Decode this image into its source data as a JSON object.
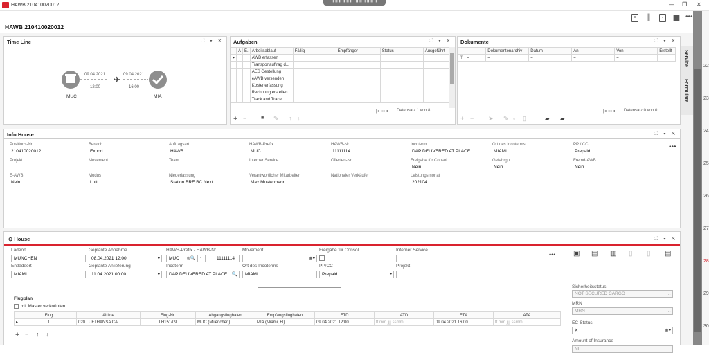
{
  "window": {
    "title": "HAWB 210410020012",
    "drag_handle": "⠿⠿⠿⠿⠿⠿ ⠿⠿⠿⠿⠿⠿"
  },
  "page_title": "HAWB 210410020012",
  "panel_controls": "⛶ ▾ ✕",
  "timeline": {
    "title": "Time Line",
    "origin": "MUC",
    "destination": "MIA",
    "leg1_date": "09.04.2021",
    "leg1_time": "12:00",
    "leg2_date": "09.04.2021",
    "leg2_time": "16:00"
  },
  "aufgaben": {
    "title": "Aufgaben",
    "columns": [
      "A",
      "E.",
      "Arbeitsablauf",
      "Fällig",
      "Empfänger",
      "Status",
      "Ausgeführt"
    ],
    "rows": [
      "AWB erfassen",
      "Transportauftrag d...",
      "AES Gestellung",
      "eAWB versenden",
      "Kostenerfassung",
      "Rechnung erstellen",
      "Track and Trace"
    ],
    "pager": "Datensatz 1 von 8"
  },
  "dokumente": {
    "title": "Dokumente",
    "columns": [
      "Dokumentenarchiv",
      "Datum",
      "An",
      "Von",
      "Erstellt"
    ],
    "filter": "=",
    "pager": "Datensatz 0 von 0"
  },
  "info_house": {
    "title": "Info House",
    "fields": [
      {
        "label": "Positions-Nr.",
        "value": "210410020012"
      },
      {
        "label": "Bereich",
        "value": "Export"
      },
      {
        "label": "Auftragsart",
        "value": "HAWB"
      },
      {
        "label": "HAWB-Prefix",
        "value": "MUC"
      },
      {
        "label": "HAWB-Nr.",
        "value": "11111114"
      },
      {
        "label": "Incoterm",
        "value": "DAP DELIVERED AT PLACE"
      },
      {
        "label": "Ort des Incoterms",
        "value": "MIAMI"
      },
      {
        "label": "PP / CC",
        "value": "Prepaid"
      },
      {
        "label": "Projekt",
        "value": ""
      },
      {
        "label": "Movement",
        "value": ""
      },
      {
        "label": "Team",
        "value": ""
      },
      {
        "label": "Interner Service",
        "value": ""
      },
      {
        "label": "Offerten-Nr.",
        "value": ""
      },
      {
        "label": "Freigabe für Consol",
        "value": "Nein"
      },
      {
        "label": "Gefahrgut",
        "value": "Nein"
      },
      {
        "label": "Fremd-AWB",
        "value": "Nein"
      },
      {
        "label": "E-AWB",
        "value": "Nein"
      },
      {
        "label": "Modus",
        "value": "Luft"
      },
      {
        "label": "Niederlassung",
        "value": "Station BRE BC Next"
      },
      {
        "label": "Verantwortlicher Mitarbeiter",
        "value": "Max Mustermann"
      },
      {
        "label": "Nationaler Verkäufer",
        "value": ""
      },
      {
        "label": "Leistungsmonat",
        "value": "202104"
      }
    ]
  },
  "house": {
    "title": "House",
    "ladeort_label": "Ladeort",
    "ladeort": "MUNCHEN",
    "abholung_label": "Geplante Abnahme",
    "abholung": "08.04.2021 12:00",
    "hawb_label": "HAWB-Prefix - HAWB-Nr.",
    "hawb_prefix": "MUC",
    "hawb_nr": "11111114",
    "movement_label": "Movement",
    "movement": "",
    "freigabe_label": "Freigabe für Consol",
    "service_label": "Interner Service",
    "service": "",
    "entladeort_label": "Entladeort",
    "entladeort": "MIAMI",
    "anlieferung_label": "Geplante Anlieferung",
    "anlieferung": "11.04.2021 00:00",
    "incoterm_label": "Incoterm",
    "incoterm": "DAP DELIVERED AT PLACE",
    "ort_label": "Ort des Incoterms",
    "ort": "MIAMI",
    "ppcc_label": "PP/CC",
    "ppcc": "Prepaid",
    "projekt_label": "Projekt",
    "projekt": "",
    "flugplan_label": "Flugplan",
    "master_label": "mit Master verknüpfen",
    "flight_columns": [
      "Flug",
      "Airline",
      "Flug-Nr.",
      "Abgangsflughafen",
      "Empfangsflughafen",
      "ETD",
      "ATD",
      "ETA",
      "ATA"
    ],
    "flight": {
      "flug": "1",
      "airline": "020 LUFTHANSA CA",
      "flugnr": "LH151/09",
      "abgang": "MUC (Muenchen)",
      "empfang": "MIA (Miami, Fl)",
      "etd": "09.04.2021 12:00",
      "atd": "tt.mm.jjjj ssmm",
      "eta": "09.04.2021 16:00",
      "ata": "tt.mm.jjjj ssmm"
    },
    "sicherheit_label": "Sicherheitsstatus",
    "sicherheit": "NOT SECURED CARGO",
    "mrn_label": "MRN",
    "mrn": "MRN",
    "ec_label": "EC-Status",
    "ec": "X",
    "insurance_label": "Amount of Insurance",
    "insurance": "NIL"
  },
  "side_tabs": {
    "service": "Service",
    "formulare": "Formulare"
  },
  "calendar": [
    "22",
    "23",
    "24",
    "25",
    "26",
    "27",
    "28",
    "29",
    "30"
  ],
  "colors": {
    "accent": "#d9232e",
    "panel_border": "#d0d0d0"
  }
}
